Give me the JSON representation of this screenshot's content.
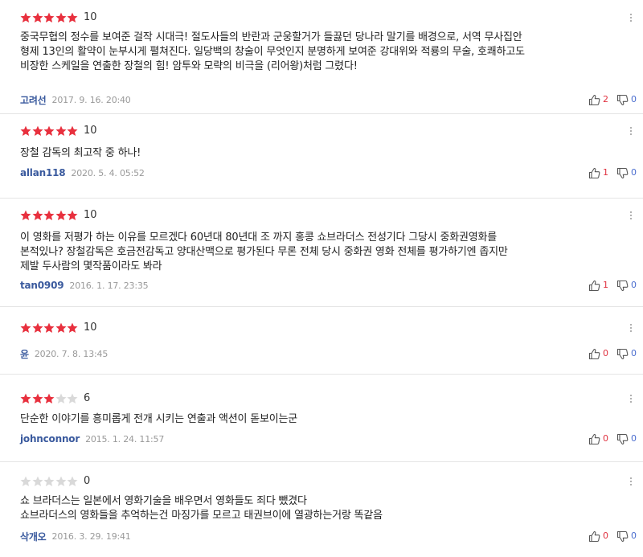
{
  "colors": {
    "star_filled": "#e8303e",
    "star_empty": "#d9d9d9",
    "author": "#3a5a9e",
    "like_count": "#e0313f",
    "dislike_count": "#4a6dcf"
  },
  "icons": {
    "like": "thumbs-up-icon",
    "dislike": "thumbs-down-icon",
    "more": "more-vertical-icon"
  },
  "reviews": [
    {
      "stars_filled": 5,
      "score": "10",
      "lines": [
        "중국무협의 정수를 보여준 걸작 시대극! 절도사들의 반란과 군웅할거가 들끓던 당나라 말기를 배경으로, 서역 무사집안",
        "형제 13인의 활약이 눈부시게 펼쳐진다. 일당백의 창술이 무엇인지 분명하게 보여준 강대위와 적룡의 무술, 호쾌하고도",
        "비장한 스케일을 연출한 장철의 힘! 암투와 모략의 비극을 (리어왕)처럼 그렸다!"
      ],
      "author": "고려선",
      "date": "2017. 9. 16. 20:40",
      "likes": "2",
      "dislikes": "0"
    },
    {
      "stars_filled": 5,
      "score": "10",
      "lines": [
        "장철 감독의 최고작 중 하나!"
      ],
      "author": "allan118",
      "date": "2020. 5. 4. 05:52",
      "likes": "1",
      "dislikes": "0"
    },
    {
      "stars_filled": 5,
      "score": "10",
      "lines": [
        "이 영화를 저평가 하는 이유를 모르겠다 60년대 80년대 조 까지 홍콩 쇼브라더스 전성기다 그당시 중화권영화를",
        "본적있나? 장철감독은 호금전감독고 양대산맥으로 평가된다 무론 전체 당시 중화권 영화 전체를 평가하기엔 좁지만",
        "제발 두사람의 몇작품이라도 봐라"
      ],
      "author": "tan0909",
      "date": "2016. 1. 17. 23:35",
      "likes": "1",
      "dislikes": "0"
    },
    {
      "stars_filled": 5,
      "score": "10",
      "lines": [],
      "author": "윤",
      "date": "2020. 7. 8. 13:45",
      "likes": "0",
      "dislikes": "0"
    },
    {
      "stars_filled": 3,
      "score": "6",
      "lines": [
        "단순한 이야기를 흥미롭게 전개 시키는 연출과 액션이 돋보이는군"
      ],
      "author": "johnconnor",
      "date": "2015. 1. 24. 11:57",
      "likes": "0",
      "dislikes": "0"
    },
    {
      "stars_filled": 0,
      "score": "0",
      "lines": [
        "쇼 브라더스는 일본에서 영화기술을 배우면서 영화들도 죄다 뺐겼다",
        "쇼브라더스의 영화들을 추억하는건 마징가를 모르고 태권브이에 열광하는거랑 똑같음"
      ],
      "author": "삭개오",
      "date": "2016. 3. 29. 19:41",
      "likes": "0",
      "dislikes": "0"
    }
  ]
}
